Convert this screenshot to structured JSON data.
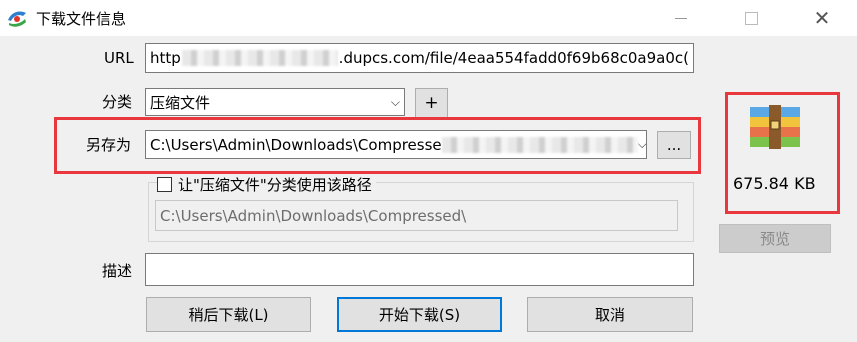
{
  "window": {
    "title": "下载文件信息"
  },
  "url": {
    "label": "URL",
    "prefix": "http",
    "visible_tail": ".dupcs.com/file/4eaa554fadd0f69b68c0a9a0c("
  },
  "category": {
    "label": "分类",
    "selected": "压缩文件",
    "add_label": "+"
  },
  "save_as": {
    "label": "另存为",
    "path": "C:\\Users\\Admin\\Downloads\\Compresse",
    "browse_label": "..."
  },
  "remember": {
    "checkbox_label": "让\"压缩文件\"分类使用该路径",
    "path": "C:\\Users\\Admin\\Downloads\\Compressed\\"
  },
  "file": {
    "size": "675.84  KB",
    "preview_label": "预览"
  },
  "description": {
    "label": "描述",
    "value": ""
  },
  "buttons": {
    "later": "稍后下载(L)",
    "start": "开始下载(S)",
    "cancel": "取消"
  },
  "colors": {
    "highlight": "#e8373d",
    "default_button_border": "#0078d7"
  }
}
